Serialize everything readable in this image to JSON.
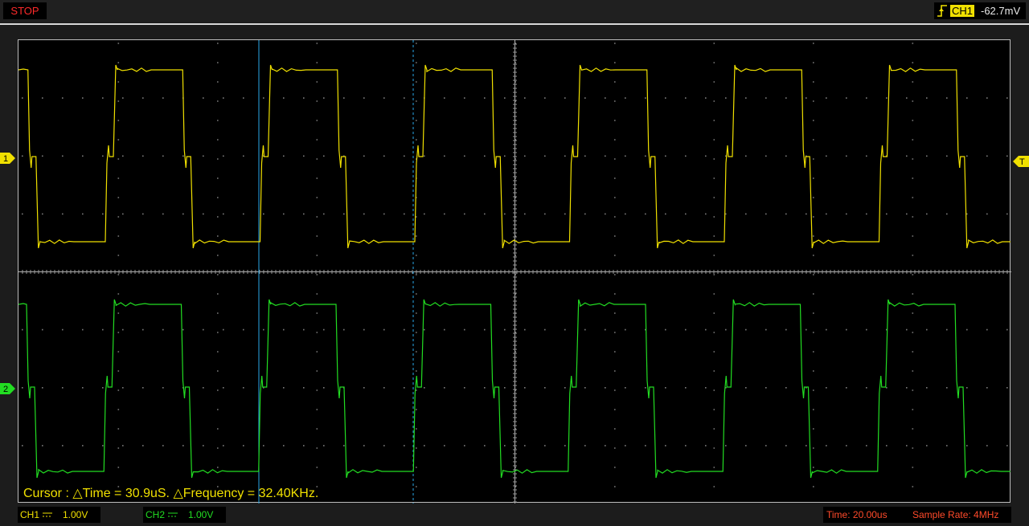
{
  "status": {
    "run_state": "STOP"
  },
  "trigger": {
    "channel": "CH1",
    "level": "-62.7mV"
  },
  "cursor_readout": "Cursor : △Time = 30.9uS. △Frequency = 32.40KHz.",
  "markers": {
    "ch1": "1",
    "ch2": "2",
    "trigger": "T"
  },
  "channels": [
    {
      "name": "CH1",
      "coupling_icon": "dc-coupling-icon",
      "volts_div": "1.00V",
      "color": "#f0e000"
    },
    {
      "name": "CH2",
      "coupling_icon": "dc-coupling-icon",
      "volts_div": "1.00V",
      "color": "#22dd22"
    }
  ],
  "timebase": {
    "time_div": "Time: 20.00us",
    "sample_rate": "Sample Rate: 4MHz"
  },
  "colors": {
    "stop": "#ff2a2a",
    "ch1": "#f0e000",
    "ch2": "#22dd22",
    "cursor": "#2aa7e8",
    "status": "#ff4a2a"
  }
}
